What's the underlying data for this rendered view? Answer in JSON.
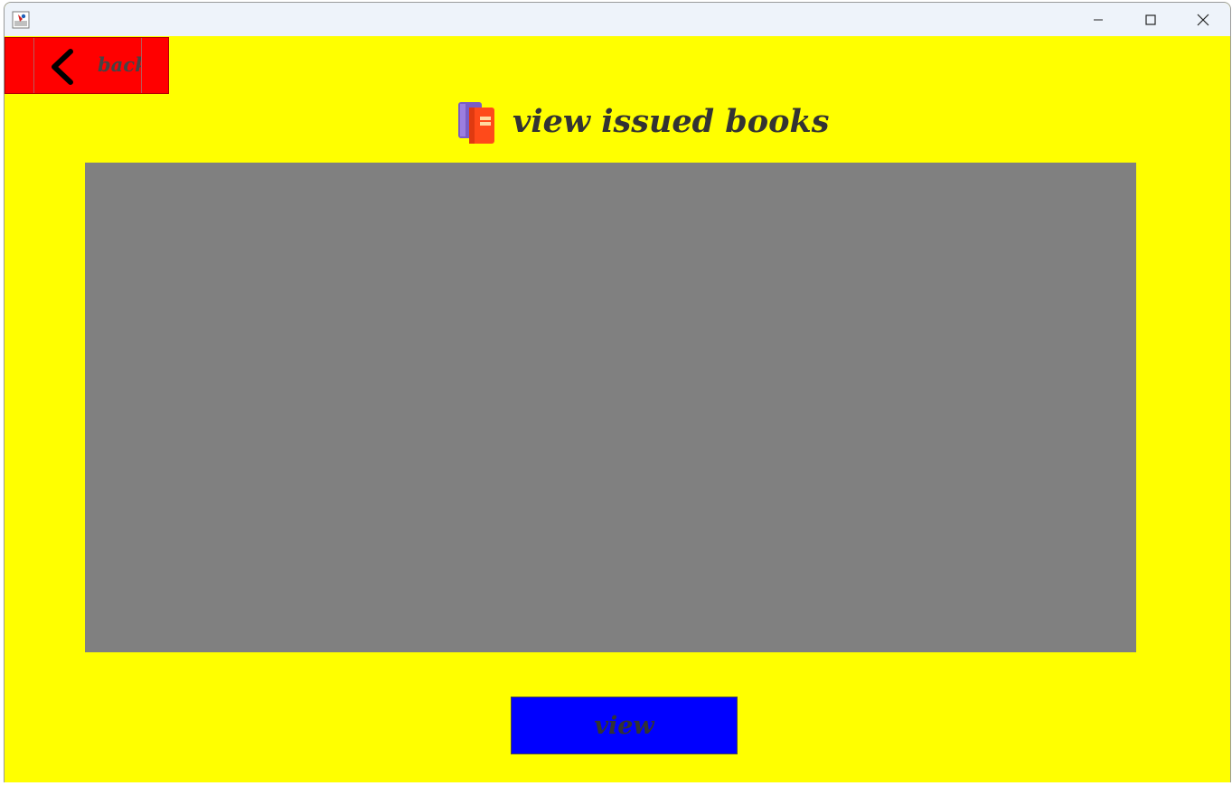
{
  "window": {
    "app_icon": "java-app-icon",
    "controls": {
      "minimize_icon": "minimize-icon",
      "maximize_icon": "maximize-icon",
      "close_icon": "close-icon"
    }
  },
  "header": {
    "back_label": "back",
    "back_icon": "chevron-left-icon",
    "title": "view issued books",
    "title_icon": "books-icon"
  },
  "table": {
    "columns": [],
    "rows": []
  },
  "footer": {
    "view_label": "view"
  },
  "colors": {
    "background": "#ffff00",
    "back_button": "#ff0000",
    "table_area": "#808080",
    "view_button": "#0000ff",
    "text": "#333333"
  }
}
